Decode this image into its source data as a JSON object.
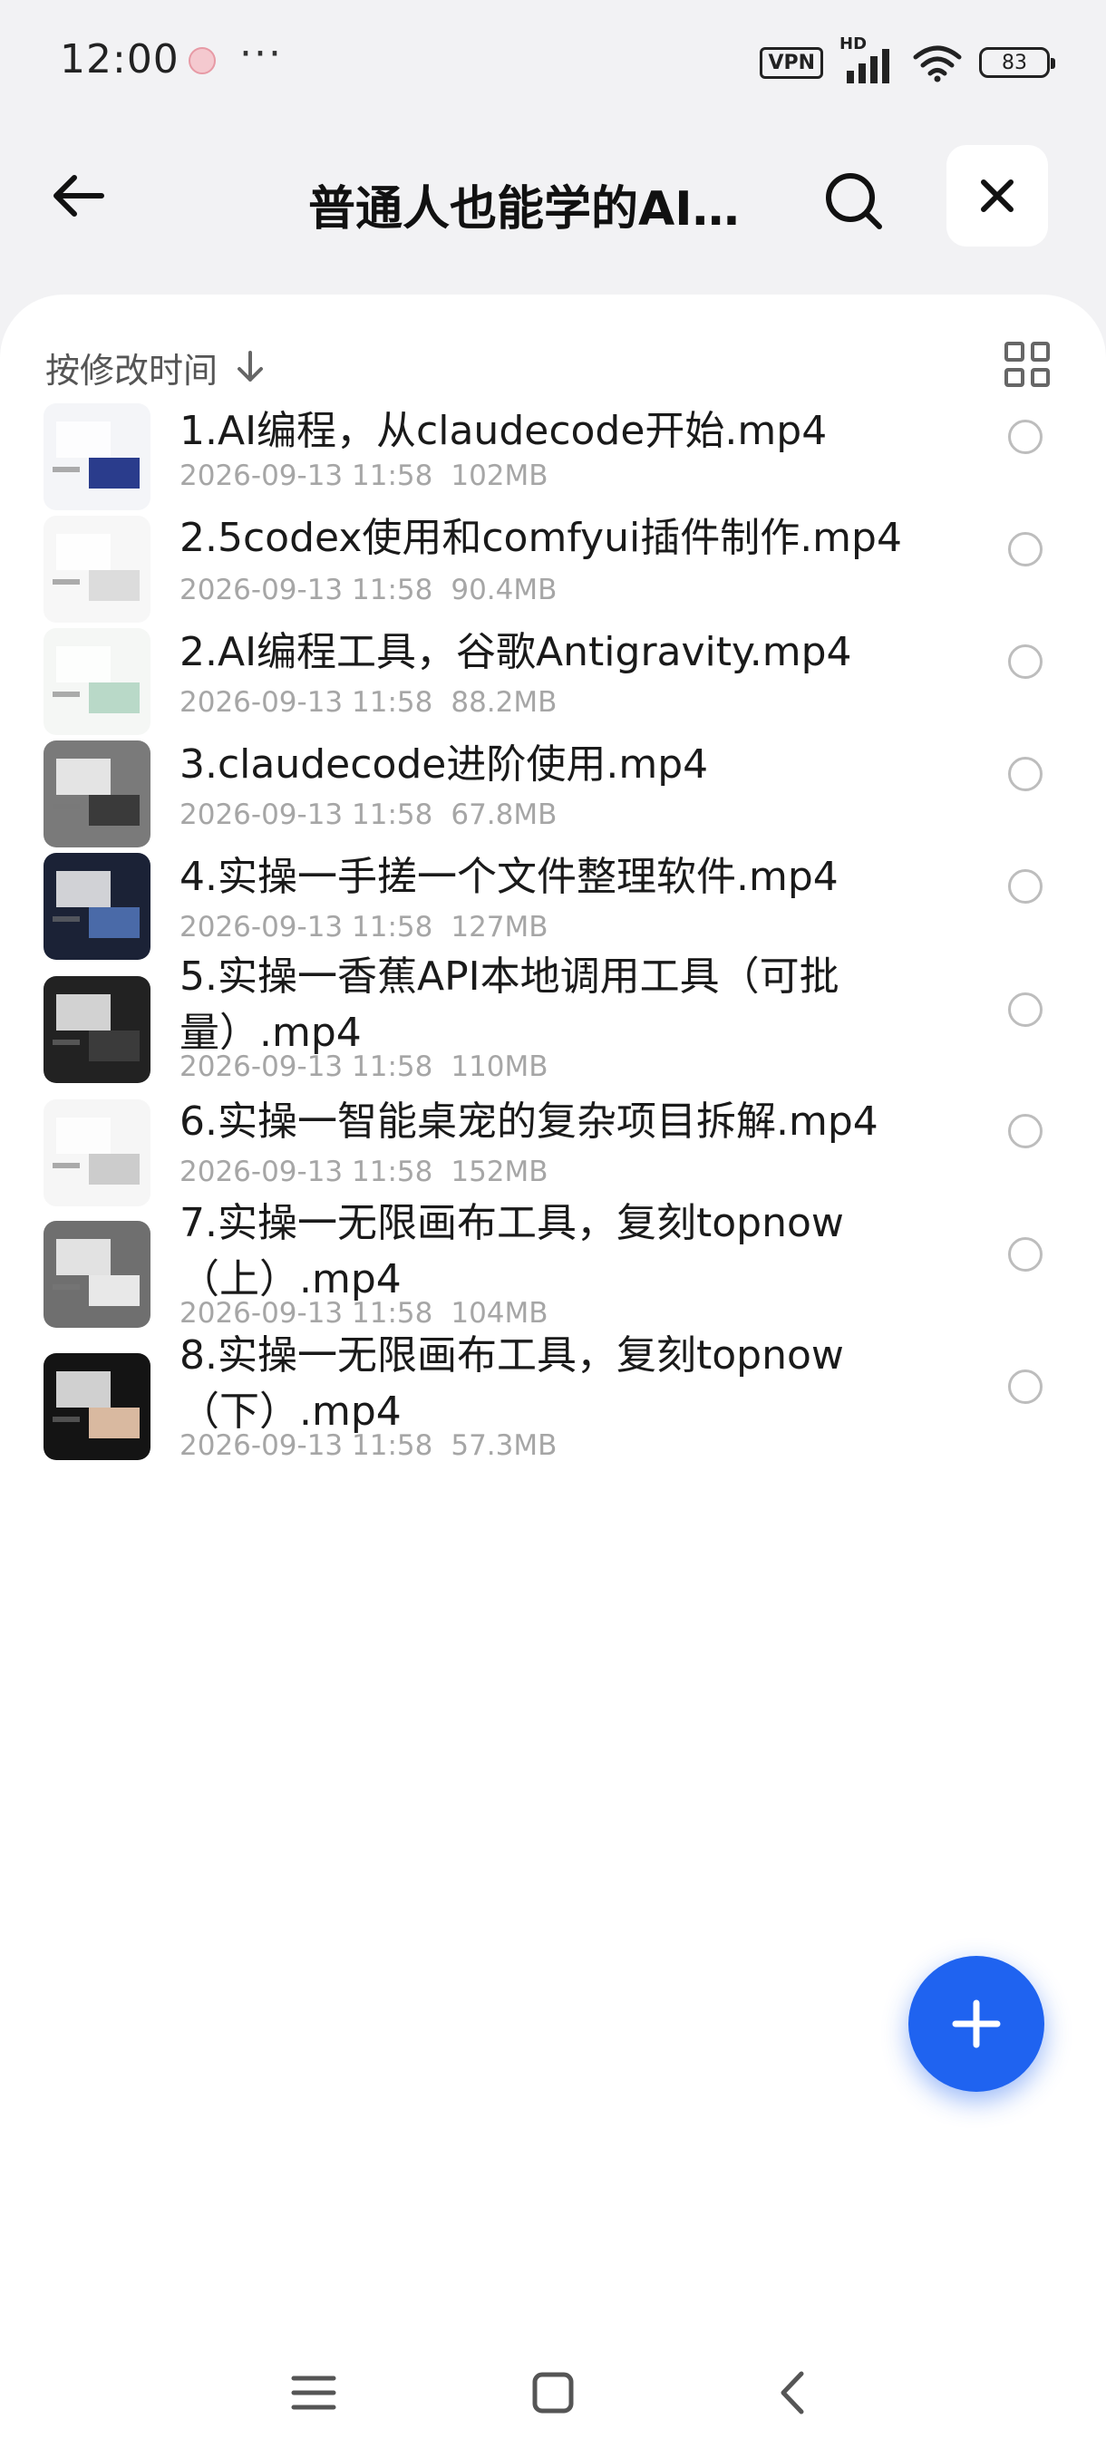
{
  "status_bar": {
    "time": "12:00",
    "more": "···",
    "vpn_label": "VPN",
    "hd_label": "HD",
    "battery_level": "83"
  },
  "header": {
    "title": "普通人也能学的AI编程课程（完结）",
    "back_icon": "arrow-left-icon",
    "search_icon": "search-icon",
    "close_icon": "close-icon"
  },
  "sort": {
    "label": "按修改时间",
    "direction_icon": "arrow-down-icon",
    "view_toggle_icon": "grid-view-icon"
  },
  "files": [
    {
      "name": "1.AI编程，从claudecode开始.mp4",
      "date": "2026-09-13 11:58",
      "size": "102MB",
      "thumb_colors": [
        "#f4f5f8",
        "#2a3c8c"
      ]
    },
    {
      "name": "2.5codex使用和comfyui插件制作.mp4",
      "date": "2026-09-13 11:58",
      "size": "90.4MB",
      "thumb_colors": [
        "#f7f7f7",
        "#dcdcdc"
      ]
    },
    {
      "name": "2.AI编程工具，谷歌Antigravity.mp4",
      "date": "2026-09-13 11:58",
      "size": "88.2MB",
      "thumb_colors": [
        "#f5f7f5",
        "#b9d9c8"
      ]
    },
    {
      "name": "3.claudecode进阶使用.mp4",
      "date": "2026-09-13 11:58",
      "size": "67.8MB",
      "thumb_colors": [
        "#7a7a7a",
        "#3a3a3a"
      ]
    },
    {
      "name": "4.实操一手搓一个文件整理软件.mp4",
      "date": "2026-09-13 11:58",
      "size": "127MB",
      "thumb_colors": [
        "#1b2236",
        "#4a6aa8"
      ]
    },
    {
      "name": "5.实操一香蕉API本地调用工具（可批量）.mp4",
      "date": "2026-09-13 11:58",
      "size": "110MB",
      "thumb_colors": [
        "#222",
        "#3b3b3b"
      ]
    },
    {
      "name": "6.实操一智能桌宠的复杂项目拆解.mp4",
      "date": "2026-09-13 11:58",
      "size": "152MB",
      "thumb_colors": [
        "#f6f6f6",
        "#cccccc"
      ]
    },
    {
      "name": "7.实操一无限画布工具，复刻topnow（上）.mp4",
      "date": "2026-09-13 11:58",
      "size": "104MB",
      "thumb_colors": [
        "#6f6f6f",
        "#e8e8e8"
      ]
    },
    {
      "name": "8.实操一无限画布工具，复刻topnow（下）.mp4",
      "date": "2026-09-13 11:58",
      "size": "57.3MB",
      "thumb_colors": [
        "#141414",
        "#d9b9a0"
      ]
    }
  ],
  "fab": {
    "icon": "plus-icon",
    "color": "#1f63f0"
  },
  "navigation": {
    "menu_icon": "menu-icon",
    "home_icon": "home-square-icon",
    "back_icon": "chevron-left-icon"
  }
}
